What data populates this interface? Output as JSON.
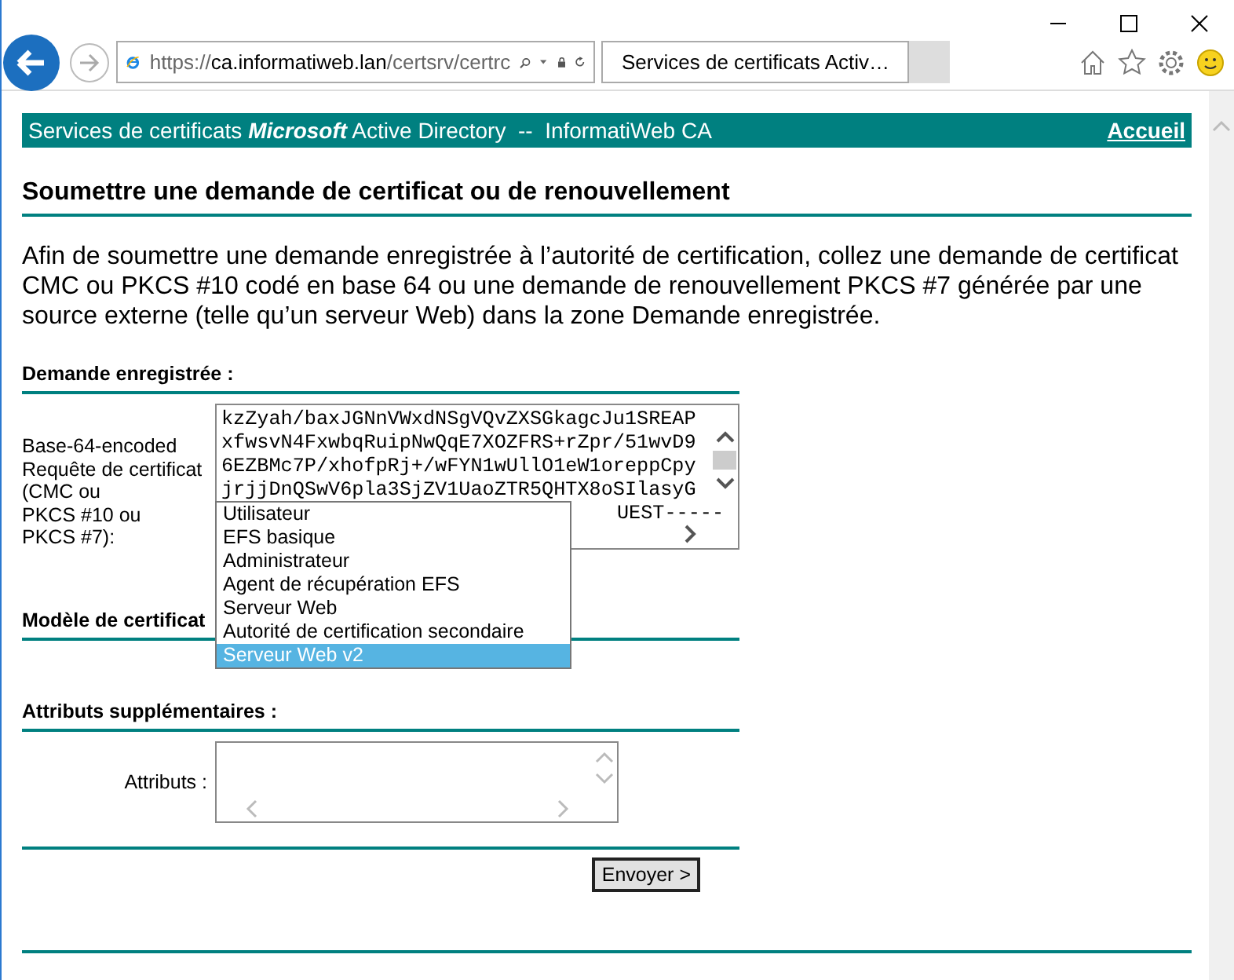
{
  "browser": {
    "address_scheme": "https://",
    "address_host": "ca.informatiweb.lan",
    "address_path": "/certsrv/certrc",
    "tab_title": "Services de certificats Activ…"
  },
  "header": {
    "title": "Services de certificats *Microsoft* Active Directory  --  InformatiWeb CA",
    "home_link": "Accueil"
  },
  "page_title": "Soumettre une demande de certificat ou de renouvellement",
  "intro": "Afin de soumettre une demande enregistrée à l’autorité de certification, collez une demande de certificat CMC ou PKCS #10 codé en base 64 ou une demande de renouvellement PKCS #7 générée par une source externe (telle qu’un serveur Web) dans la zone Demande enregistrée.",
  "saved_request": {
    "heading": "Demande enregistrée :",
    "label_lines": [
      "Base-64-encoded",
      "Requête de certificat",
      "(CMC ou",
      "PKCS #10 ou",
      "PKCS #7):"
    ],
    "lines": [
      "kzZyah/baxJGNnVWxdNSgVQvZXSGkagcJu1SREAP",
      "xfwsvN4FxwbqRuipNwQqE7XOZFRS+rZpr/51wvD9",
      "6EZBMc7P/xhofpRj+/wFYN1wUllO1eW1oreppCpy",
      "jrjjDnQSwV6pla3SjZV1UaoZTR5QHTX8oSIlasyG"
    ],
    "partial_line": "UEST-----"
  },
  "template": {
    "heading": "Modèle de certificat",
    "options": [
      {
        "label": "Utilisateur",
        "selected": false
      },
      {
        "label": "EFS basique",
        "selected": false
      },
      {
        "label": "Administrateur",
        "selected": false
      },
      {
        "label": "Agent de récupération EFS",
        "selected": false
      },
      {
        "label": "Serveur Web",
        "selected": false
      },
      {
        "label": "Autorité de certification secondaire",
        "selected": false
      },
      {
        "label": "Serveur Web v2",
        "selected": true
      }
    ]
  },
  "attributes": {
    "heading": "Attributs supplémentaires :",
    "label": "Attributs :"
  },
  "submit_button": "Envoyer >"
}
